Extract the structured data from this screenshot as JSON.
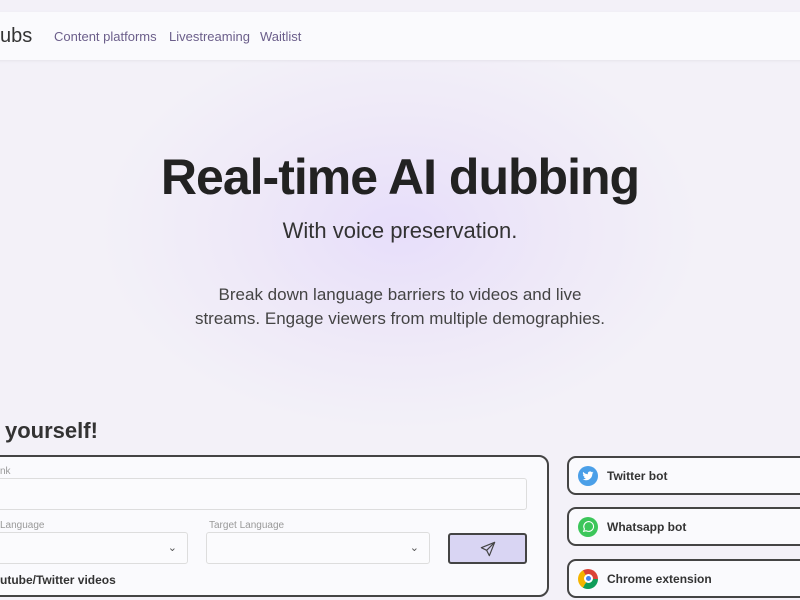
{
  "nav": {
    "logo": "ubs",
    "links": [
      "Content platforms",
      "Livestreaming",
      "Waitlist"
    ]
  },
  "hero": {
    "title": "Real-time AI dubbing",
    "subtitle": "With voice preservation.",
    "description_line1": "Break down language barriers to videos and live",
    "description_line2": "streams. Engage viewers from multiple demographies."
  },
  "try": {
    "heading": "yourself!",
    "link_label": "nk",
    "link_value": "",
    "source_label": "Language",
    "target_label": "Target Language",
    "source_value": "",
    "target_value": "",
    "send_icon": "paper-plane-icon",
    "note": "utube/Twitter videos"
  },
  "options": [
    {
      "label": "Twitter bot",
      "icon": "twitter-icon",
      "color": "#4a9fe8"
    },
    {
      "label": "Whatsapp bot",
      "icon": "whatsapp-icon",
      "color": "#3cc65a"
    },
    {
      "label": "Chrome extension",
      "icon": "chrome-icon",
      "color": "#db4437"
    }
  ],
  "colors": {
    "accent": "#d9d5f3",
    "nav_link": "#6b5e8a"
  }
}
